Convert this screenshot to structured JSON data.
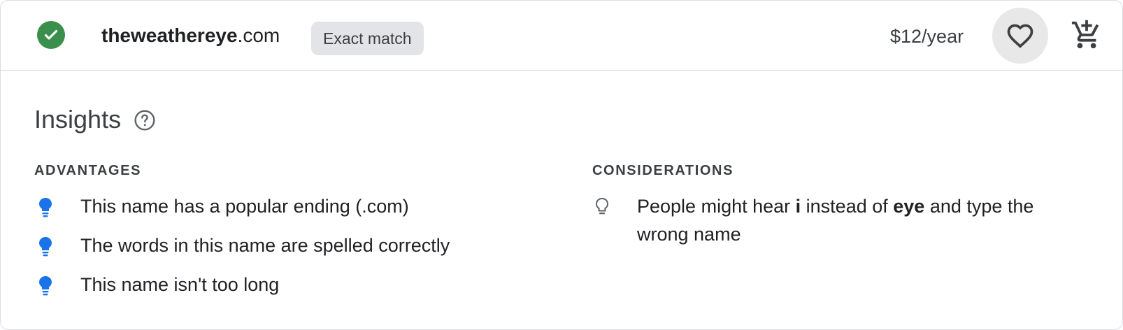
{
  "domain": {
    "sld": "theweathereye",
    "tld": ".com",
    "match_label": "Exact match",
    "price": "$12/year"
  },
  "insights": {
    "title": "Insights",
    "advantages": {
      "heading": "ADVANTAGES",
      "items": [
        "This name has a popular ending (.com)",
        "The words in this name are spelled correctly",
        "This name isn't too long"
      ]
    },
    "considerations": {
      "heading": "CONSIDERATIONS",
      "item": {
        "part1": "People might hear ",
        "bold1": "i",
        "part2": " instead of ",
        "bold2": "eye",
        "part3": " and type the wrong name"
      }
    }
  },
  "icons": {
    "status": "check-circle-icon",
    "favorite": "heart-outline-icon",
    "cart": "add-shopping-cart-icon",
    "help": "help-outline-icon",
    "advantage_bullet": "lightbulb-filled-icon",
    "consideration_bullet": "lightbulb-outline-icon"
  },
  "colors": {
    "success": "#3a8f4c",
    "accent": "#1a73e8",
    "chip_bg": "#e3e4e8",
    "text": "#202124"
  }
}
